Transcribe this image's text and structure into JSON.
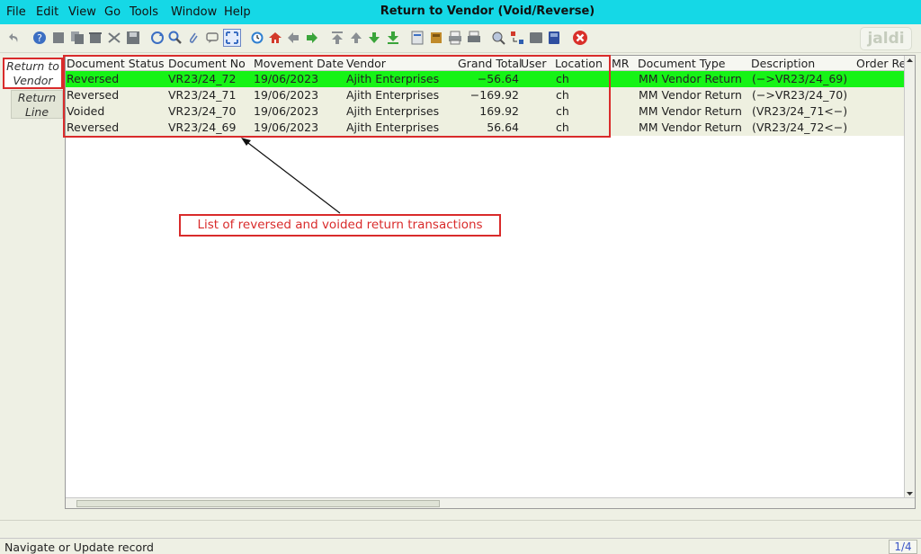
{
  "menu": [
    "File",
    "Edit",
    "View",
    "Go",
    "Tools",
    "Window",
    "Help"
  ],
  "window_title": "Return to Vendor (Void/Reverse)",
  "logo_text": "jaldi",
  "tabs": {
    "active": "Return to Vendor",
    "line": "Return Line"
  },
  "grid": {
    "columns": [
      "Document Status",
      "Document No",
      "Movement Date",
      "Vendor",
      "Grand Total",
      "User",
      "Location",
      "MR",
      "Document Type",
      "Description",
      "Order Ref"
    ],
    "rows": [
      {
        "status": "Reversed",
        "doc_no": "VR23/24_72",
        "date": "19/06/2023",
        "vendor": "Ajith Enterprises",
        "total": "−56.64",
        "location": "ch",
        "doc_type": "MM Vendor Return",
        "description": "(−>VR23/24_69)"
      },
      {
        "status": "Reversed",
        "doc_no": "VR23/24_71",
        "date": "19/06/2023",
        "vendor": "Ajith Enterprises",
        "total": "−169.92",
        "location": "ch",
        "doc_type": "MM Vendor Return",
        "description": "(−>VR23/24_70)"
      },
      {
        "status": "Voided",
        "doc_no": "VR23/24_70",
        "date": "19/06/2023",
        "vendor": "Ajith Enterprises",
        "total": "169.92",
        "location": "ch",
        "doc_type": "MM Vendor Return",
        "description": "(VR23/24_71<−)"
      },
      {
        "status": "Reversed",
        "doc_no": "VR23/24_69",
        "date": "19/06/2023",
        "vendor": "Ajith Enterprises",
        "total": "56.64",
        "location": "ch",
        "doc_type": "MM Vendor Return",
        "description": "(VR23/24_72<−)"
      }
    ]
  },
  "annotation": "List of reversed and voided return transactions",
  "status": {
    "message": "Navigate or Update record",
    "page": "1/4"
  },
  "toolbar_icons": [
    "undo-icon",
    "help-icon",
    "new-icon",
    "copy-icon",
    "delete-icon",
    "cut-icon",
    "save-icon",
    "refresh-icon",
    "find-icon",
    "attachment-icon",
    "chat-icon",
    "grid-toggle-icon",
    "history-icon",
    "home-icon",
    "previous-icon",
    "next-icon",
    "first-record-icon",
    "previous-record-icon",
    "next-record-icon",
    "last-record-icon",
    "report-icon",
    "archive-icon",
    "print-preview-icon",
    "print-icon",
    "zoom-across-icon",
    "request-icon",
    "product-info-icon",
    "workflow-icon",
    "end-icon"
  ],
  "colors": {
    "menubar": "#15d8e6",
    "selected_row": "#16f316",
    "annotation_red": "#d92b2b"
  }
}
